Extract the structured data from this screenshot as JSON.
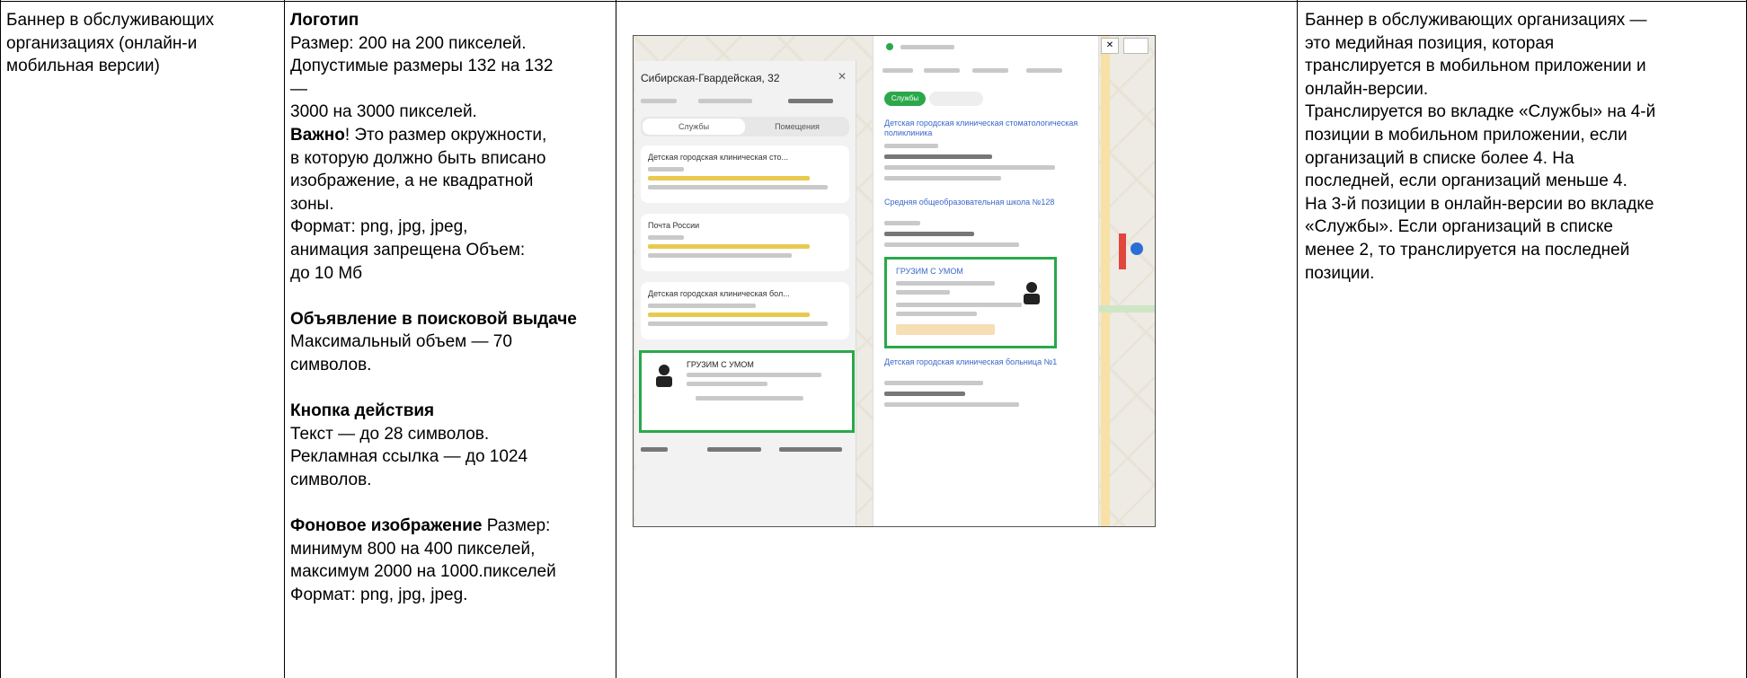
{
  "col1": {
    "lines": [
      "Баннер в обслуживающих",
      "организациях (онлайн-и",
      "мобильная версии)"
    ]
  },
  "col2": {
    "logo_title": "Логотип",
    "logo_size": "Размер: 200 на 200 пикселей.",
    "logo_allowed_1": "Допустимые размеры 132 на 132",
    "logo_allowed_2": "—",
    "logo_allowed_3": "3000 на 3000 пикселей.",
    "important_bold": "Важно",
    "important_rest": "! Это размер окружности,",
    "important_2": "в которую должно быть вписано",
    "important_3": "изображение, а не квадратной",
    "important_4": "зоны.",
    "format_1": "Формат: png, jpg, jpeg,",
    "format_2": "анимация запрещена Объем:",
    "format_3": "до 10 Мб",
    "ad_title": "Объявление в поисковой выдаче",
    "ad_1": "Максимальный объем — 70",
    "ad_2": "символов.",
    "btn_title": "Кнопка действия",
    "btn_1": "Текст — до 28 символов.",
    "btn_2": "Рекламная ссылка — до 1024",
    "btn_3": "символов.",
    "bg_title": "Фоновое изображение",
    "bg_title_rest": " Размер:",
    "bg_1": "минимум 800 на 400 пикселей,",
    "bg_2": "максимум 2000 на 1000.пикселей",
    "bg_3": "Формат: png, jpg, jpeg."
  },
  "screenshot": {
    "left_title": "Сибирская-Гвардейская, 32",
    "left_tab_1": "Службы",
    "left_tab_2": "Помещения",
    "left_card_1": "Детская городская клиническая сто...",
    "left_card_2": "Почта России",
    "left_card_3": "Детская городская клиническая бол...",
    "left_banner": "ГРУЗИМ С УМОМ",
    "right_chip": "Службы",
    "right_org_1": "Детская городская клиническая стоматологическая поликлиника",
    "right_org_2": "Средняя общеобразовательная школа №128",
    "right_banner": "ГРУЗИМ С УМОМ",
    "right_org_3": "Детская городская клиническая больница №1",
    "accent_green": "#2aa84a",
    "accent_link": "#3a66cc"
  },
  "col4": {
    "lines": [
      "Баннер в обслуживающих организациях —",
      "это медийная позиция, которая",
      "транслируется в мобильном приложении и",
      "онлайн-версии.",
      "Транслируется во вкладке «Службы» на 4-й",
      "позиции в мобильном приложении, если",
      "организаций в списке более 4. На",
      "последней, если организаций меньше 4.",
      "На 3-й позиции в онлайн-версии во вкладке",
      "«Службы». Если организаций в списке",
      "менее 2, то транслируется на последней",
      "позиции."
    ]
  }
}
